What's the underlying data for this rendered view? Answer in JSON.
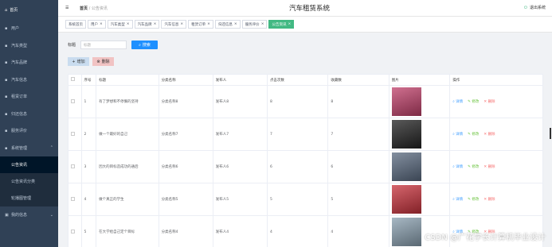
{
  "app_title": "汽车租赁系统",
  "logout_label": "退出系统",
  "breadcrumb": {
    "home": "首页",
    "current": "公告资讯"
  },
  "sidebar": {
    "home_label": "首页",
    "items": [
      {
        "label": "用户"
      },
      {
        "label": "汽车类型"
      },
      {
        "label": "汽车品牌"
      },
      {
        "label": "汽车信息"
      },
      {
        "label": "租赁订单"
      },
      {
        "label": "归还信息"
      },
      {
        "label": "服务评价"
      },
      {
        "label": "系统管理"
      }
    ],
    "subitems": [
      {
        "label": "公告资讯",
        "active": true
      },
      {
        "label": "公告资讯分类",
        "active": false
      },
      {
        "label": "轮播图管理",
        "active": false
      }
    ],
    "last_item": "我的信息"
  },
  "tabs": [
    {
      "label": "系统首页",
      "closable": false,
      "active": false
    },
    {
      "label": "用户",
      "closable": true,
      "active": false
    },
    {
      "label": "汽车类型",
      "closable": true,
      "active": false
    },
    {
      "label": "汽车品牌",
      "closable": true,
      "active": false
    },
    {
      "label": "汽车信息",
      "closable": true,
      "active": false
    },
    {
      "label": "租赁订单",
      "closable": true,
      "active": false
    },
    {
      "label": "归还信息",
      "closable": true,
      "active": false
    },
    {
      "label": "服务评价",
      "closable": true,
      "active": false
    },
    {
      "label": "公告资讯",
      "closable": true,
      "active": true
    }
  ],
  "search": {
    "label": "标题",
    "placeholder": "标题",
    "button": "搜索"
  },
  "buttons": {
    "add": "增加",
    "delete": "删除"
  },
  "table": {
    "headers": [
      "序号",
      "标题",
      "分类名称",
      "发布人",
      "点击次数",
      "收藏数",
      "图片",
      "操作"
    ],
    "rows": [
      {
        "no": "1",
        "title": "有了梦想和不停懈的坚持",
        "category": "分类名称8",
        "publisher": "发布人8",
        "clicks": "8",
        "favs": "8",
        "img_color": "#c0406a"
      },
      {
        "no": "2",
        "title": "做一个最好的自己",
        "category": "分类名称7",
        "publisher": "发布人7",
        "clicks": "7",
        "favs": "7",
        "img_color": "#222222"
      },
      {
        "no": "3",
        "title": "因大的目标造成功的通后",
        "category": "分类名称6",
        "publisher": "发布人6",
        "clicks": "6",
        "favs": "6",
        "img_color": "#5a6a80"
      },
      {
        "no": "4",
        "title": "做个真正的学生",
        "category": "分类名称5",
        "publisher": "发布人5",
        "clicks": "5",
        "favs": "5",
        "img_color": "#c8323c"
      },
      {
        "no": "5",
        "title": "在大学给自己定个目标",
        "category": "分类名称4",
        "publisher": "发布人4",
        "clicks": "4",
        "favs": "4",
        "img_color": "#8aa0b0"
      }
    ],
    "ops": {
      "detail": "详情",
      "edit": "修改",
      "delete": "删除"
    }
  },
  "watermark": "CSDN @广花学长计算机毕业设计",
  "colors": {
    "sidebar": "#304156",
    "accent": "#42b983",
    "primary": "#1e90ff"
  }
}
